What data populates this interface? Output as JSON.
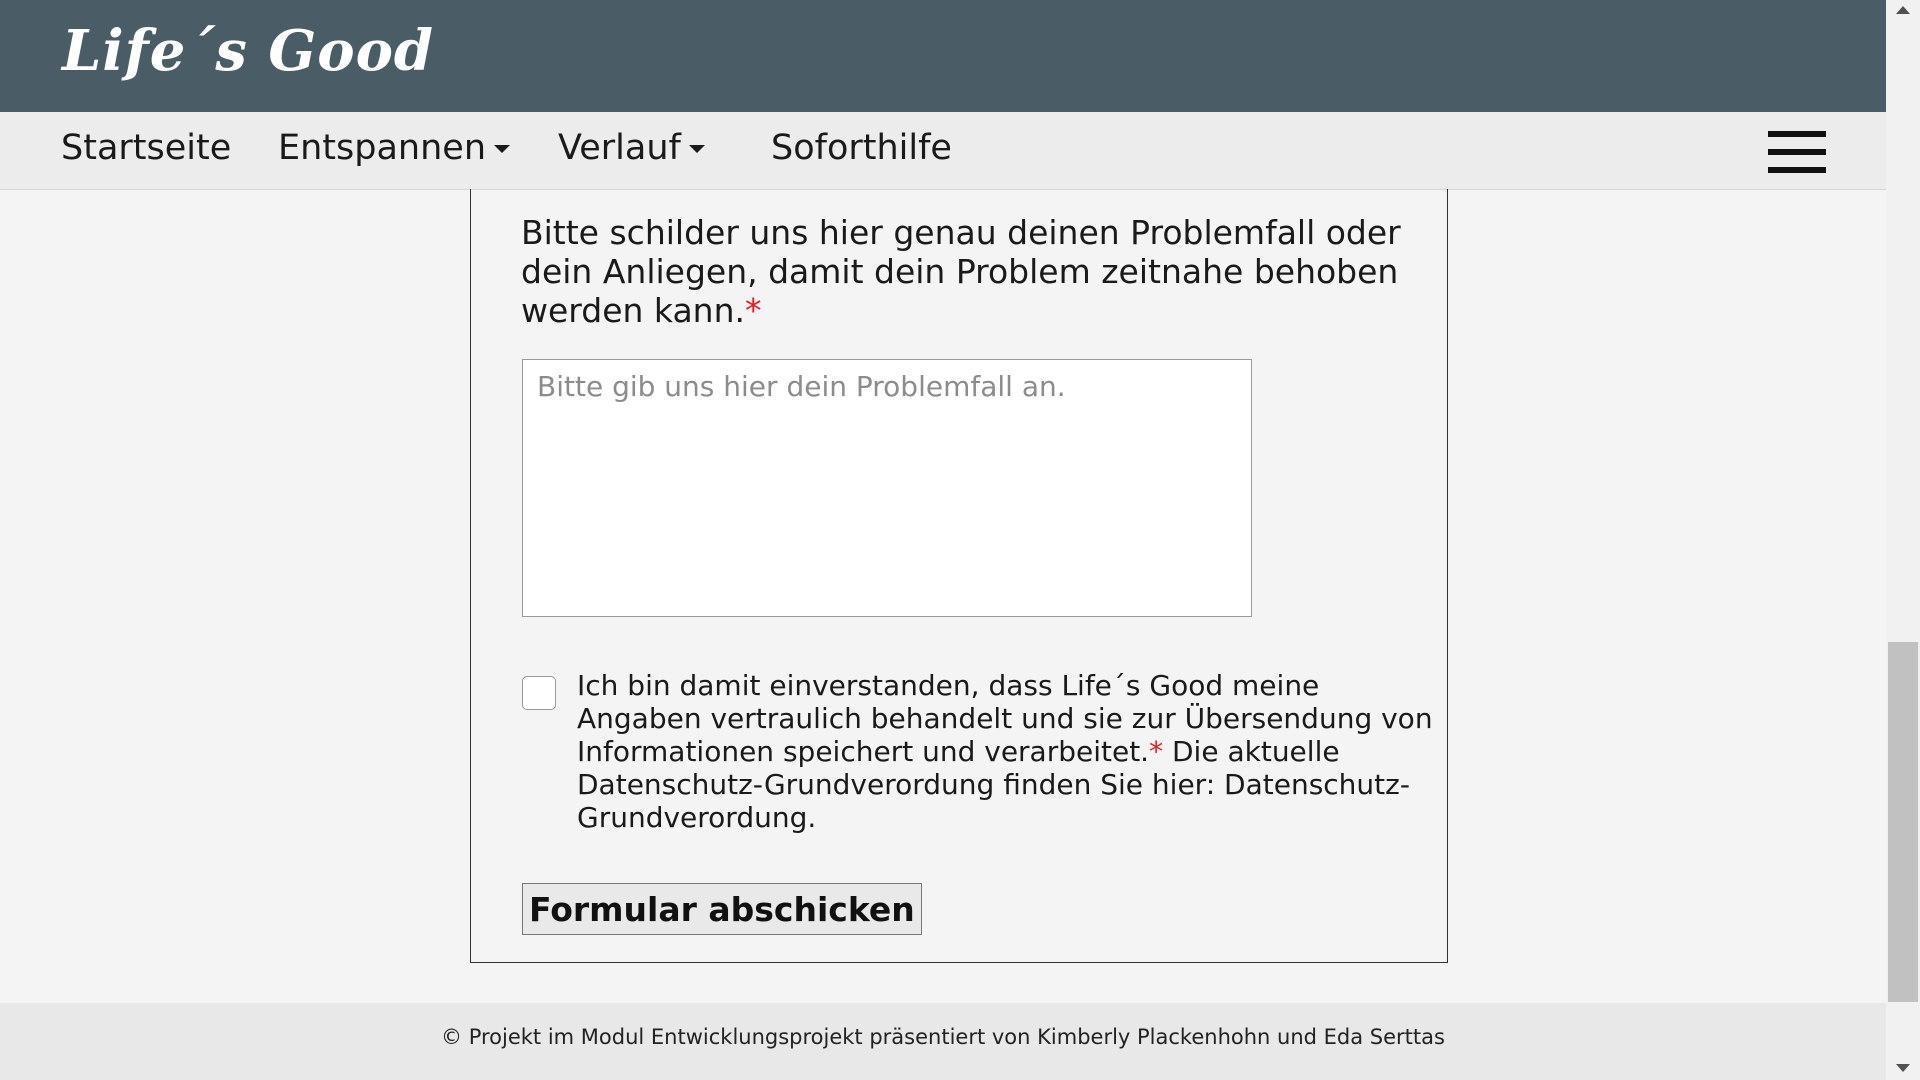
{
  "header": {
    "logo": "Life´s Good",
    "background": "#4a5d67"
  },
  "nav": {
    "items": [
      {
        "label": "Startseite",
        "dropdown": false
      },
      {
        "label": "Entspannen",
        "dropdown": true
      },
      {
        "label": "Verlauf",
        "dropdown": true
      },
      {
        "label": "Soforthilfe",
        "dropdown": false
      }
    ],
    "menu_icon": "hamburger-menu-icon"
  },
  "form": {
    "question": "Bitte schilder uns hier genau deinen Problemfall oder dein Anliegen, damit dein Problem zeitnahe behoben werden kann.",
    "required_marker": "*",
    "textarea_placeholder": "Bitte gib uns hier dein Problemfall an.",
    "textarea_value": "",
    "consent_checked": false,
    "consent_text_part1": "Ich bin damit einverstanden, dass Life´s Good meine Angaben vertraulich behandelt und sie zur Übersendung von Informationen speichert und verarbeitet.",
    "consent_text_part2": " Die aktuelle Datenschutz-Grundverordung finden Sie hier: Datenschutz-Grundverordung.",
    "submit_label": "Formular abschicken",
    "required_color": "#e02020"
  },
  "footer": {
    "text": "© Projekt im Modul Entwicklungsprojekt präsentiert von Kimberly Plackenhohn und Eda Serttas"
  }
}
